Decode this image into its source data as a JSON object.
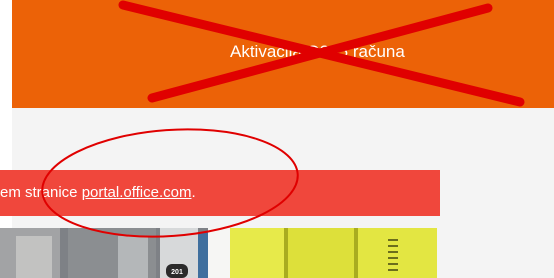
{
  "header": {
    "title": "Aktivacija O365 računa"
  },
  "alert": {
    "text_before_link": "em stranice ",
    "link_text": "portal.office.com",
    "text_after_link": "."
  },
  "photo": {
    "room_number": "201"
  },
  "colors": {
    "header_background": "#ec6207",
    "alert_background": "#f0473c",
    "content_background": "#f4f4f4",
    "annotation_red": "#e00000"
  }
}
